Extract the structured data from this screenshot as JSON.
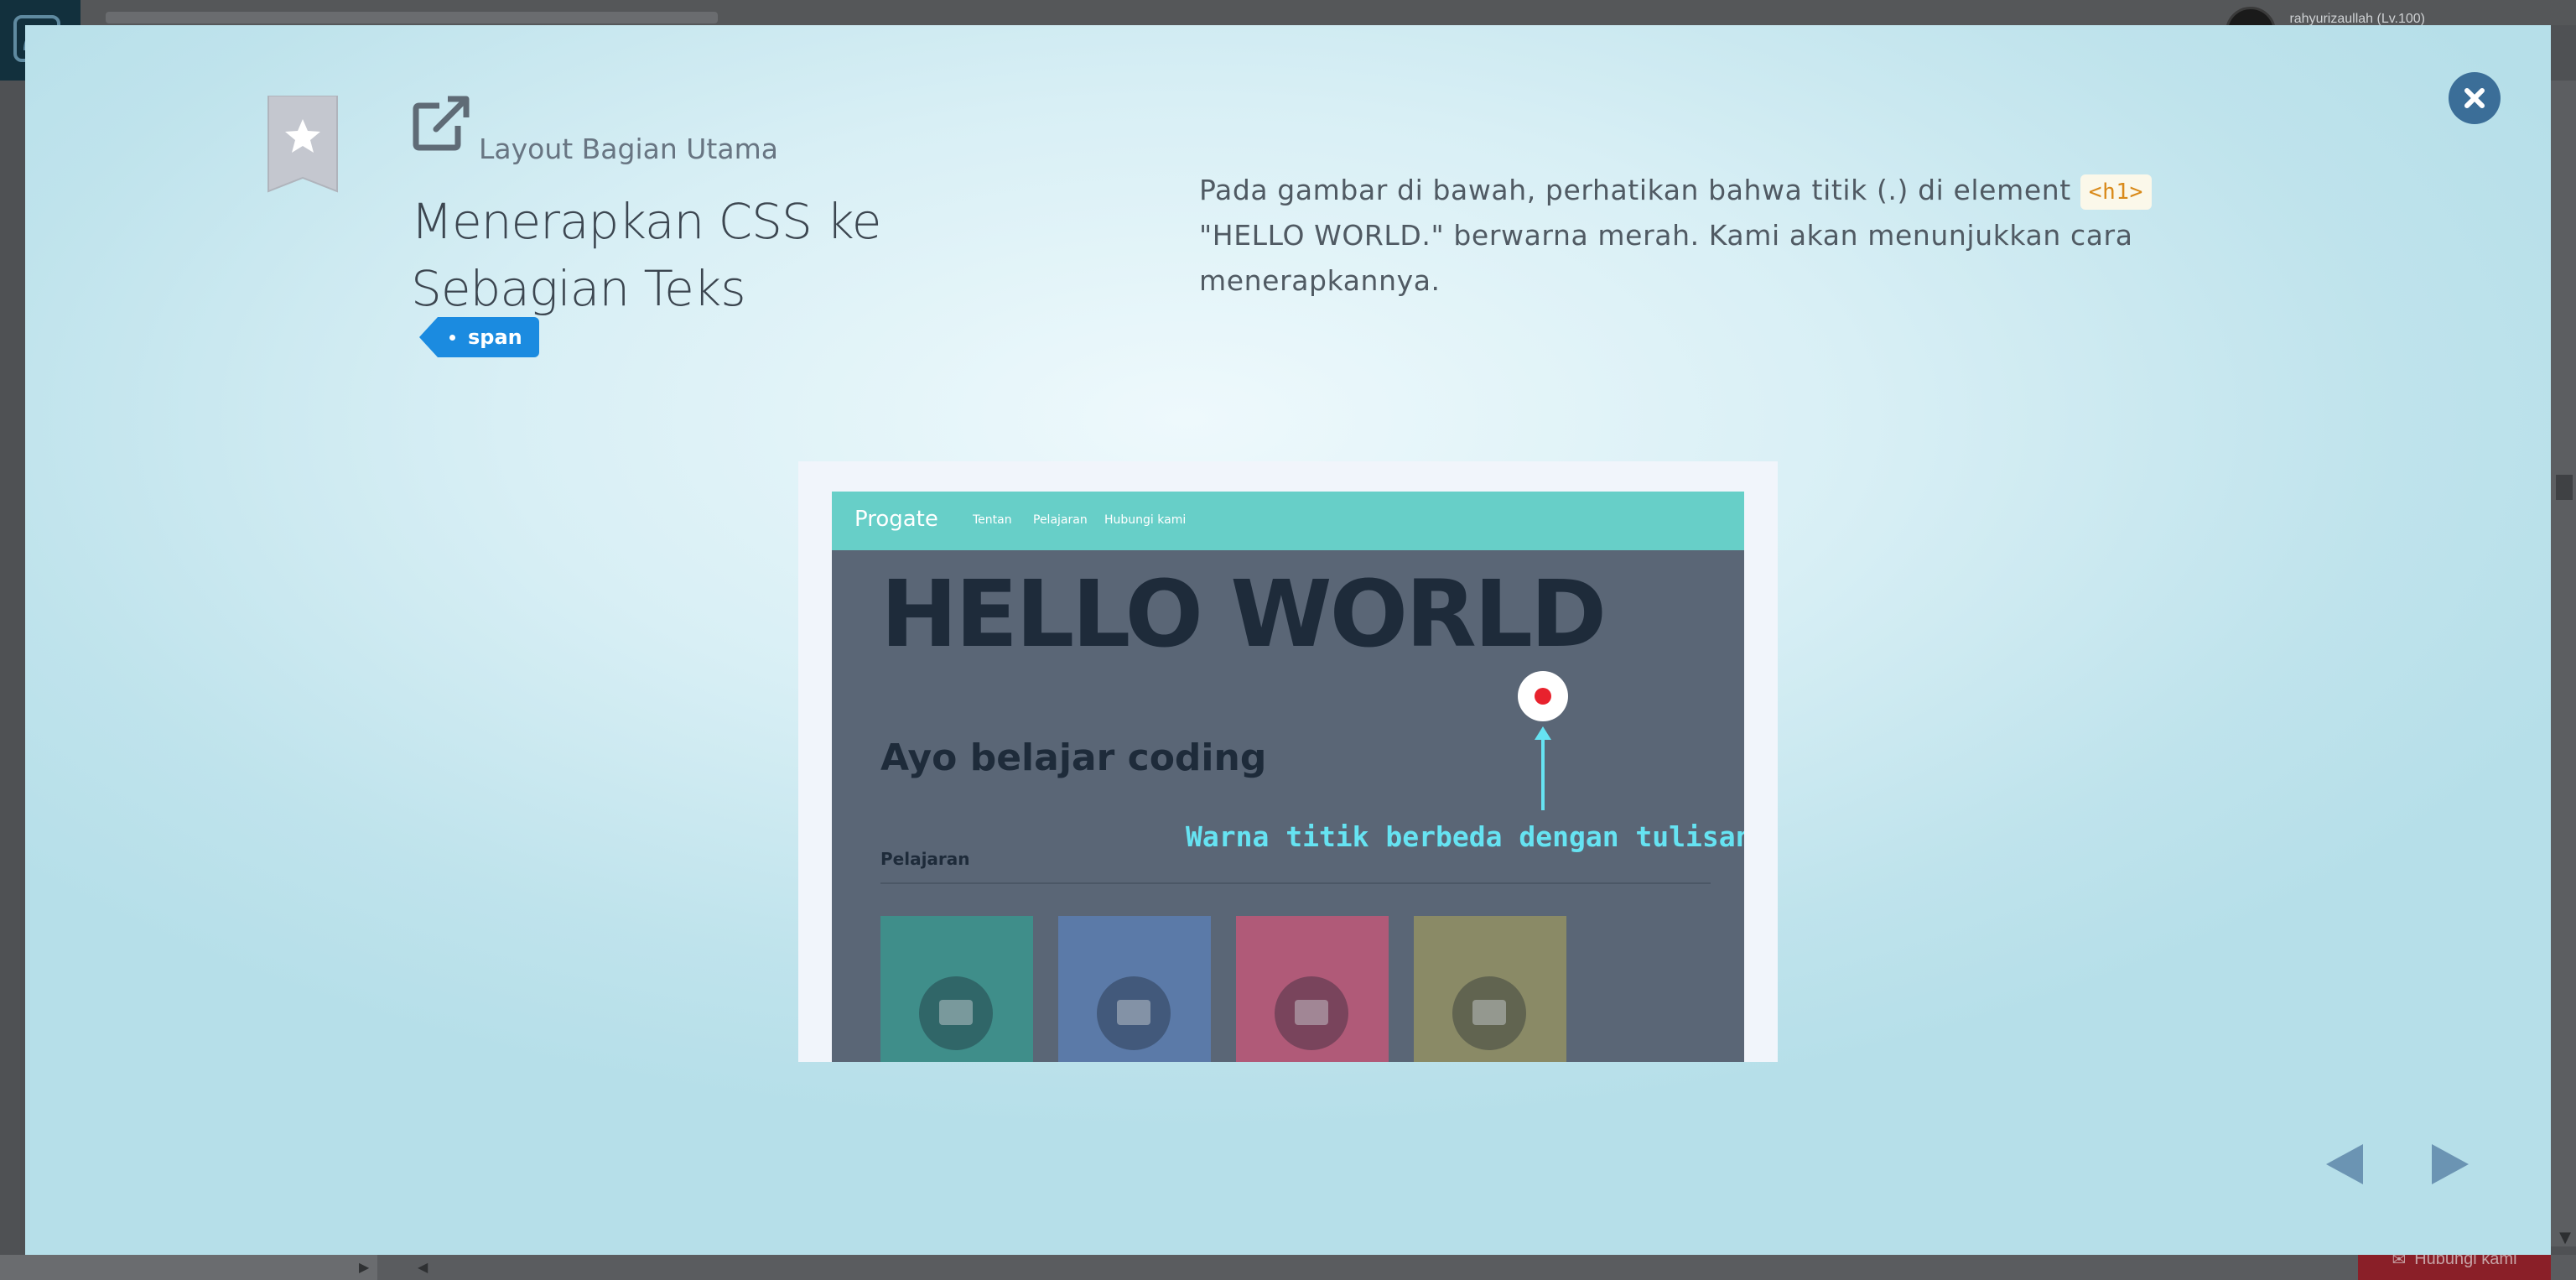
{
  "background": {
    "username": "rahyurizaullah (Lv.100)",
    "contact_button": "Hubungi kami"
  },
  "modal": {
    "section_title": "Layout Bagian Utama",
    "lesson_title_line1": "Menerapkan CSS ke",
    "lesson_title_line2": "Sebagian Teks",
    "tag_label": "span",
    "description": {
      "part1": "Pada gambar di bawah, perhatikan bahwa titik (.) di element ",
      "code": "<h1>",
      "part2": " \"HELLO WORLD.\" berwarna merah. Kami akan menunjukkan cara menerapkannya."
    },
    "icons": {
      "close": "close-icon",
      "bookmark": "bookmark-star-icon",
      "external": "external-link-icon",
      "prev": "arrow-left-icon",
      "next": "arrow-right-icon"
    }
  },
  "illustration": {
    "logo": "Progate",
    "nav_links": [
      "Tentan",
      "Pelajaran",
      "Hubungi kami"
    ],
    "headline": "HELLO WORLD",
    "subheadline": "Ayo belajar coding",
    "annotation": "Warna titik berbeda dengan tulisan.",
    "section_label": "Pelajaran",
    "card_colors": [
      "#3f8e8a",
      "#5b7aa8",
      "#b05a78",
      "#8a8a66"
    ],
    "accent_colors": {
      "dot": "#e8222d",
      "annotation": "#66e3f2",
      "nav": "#67cfc8"
    }
  }
}
